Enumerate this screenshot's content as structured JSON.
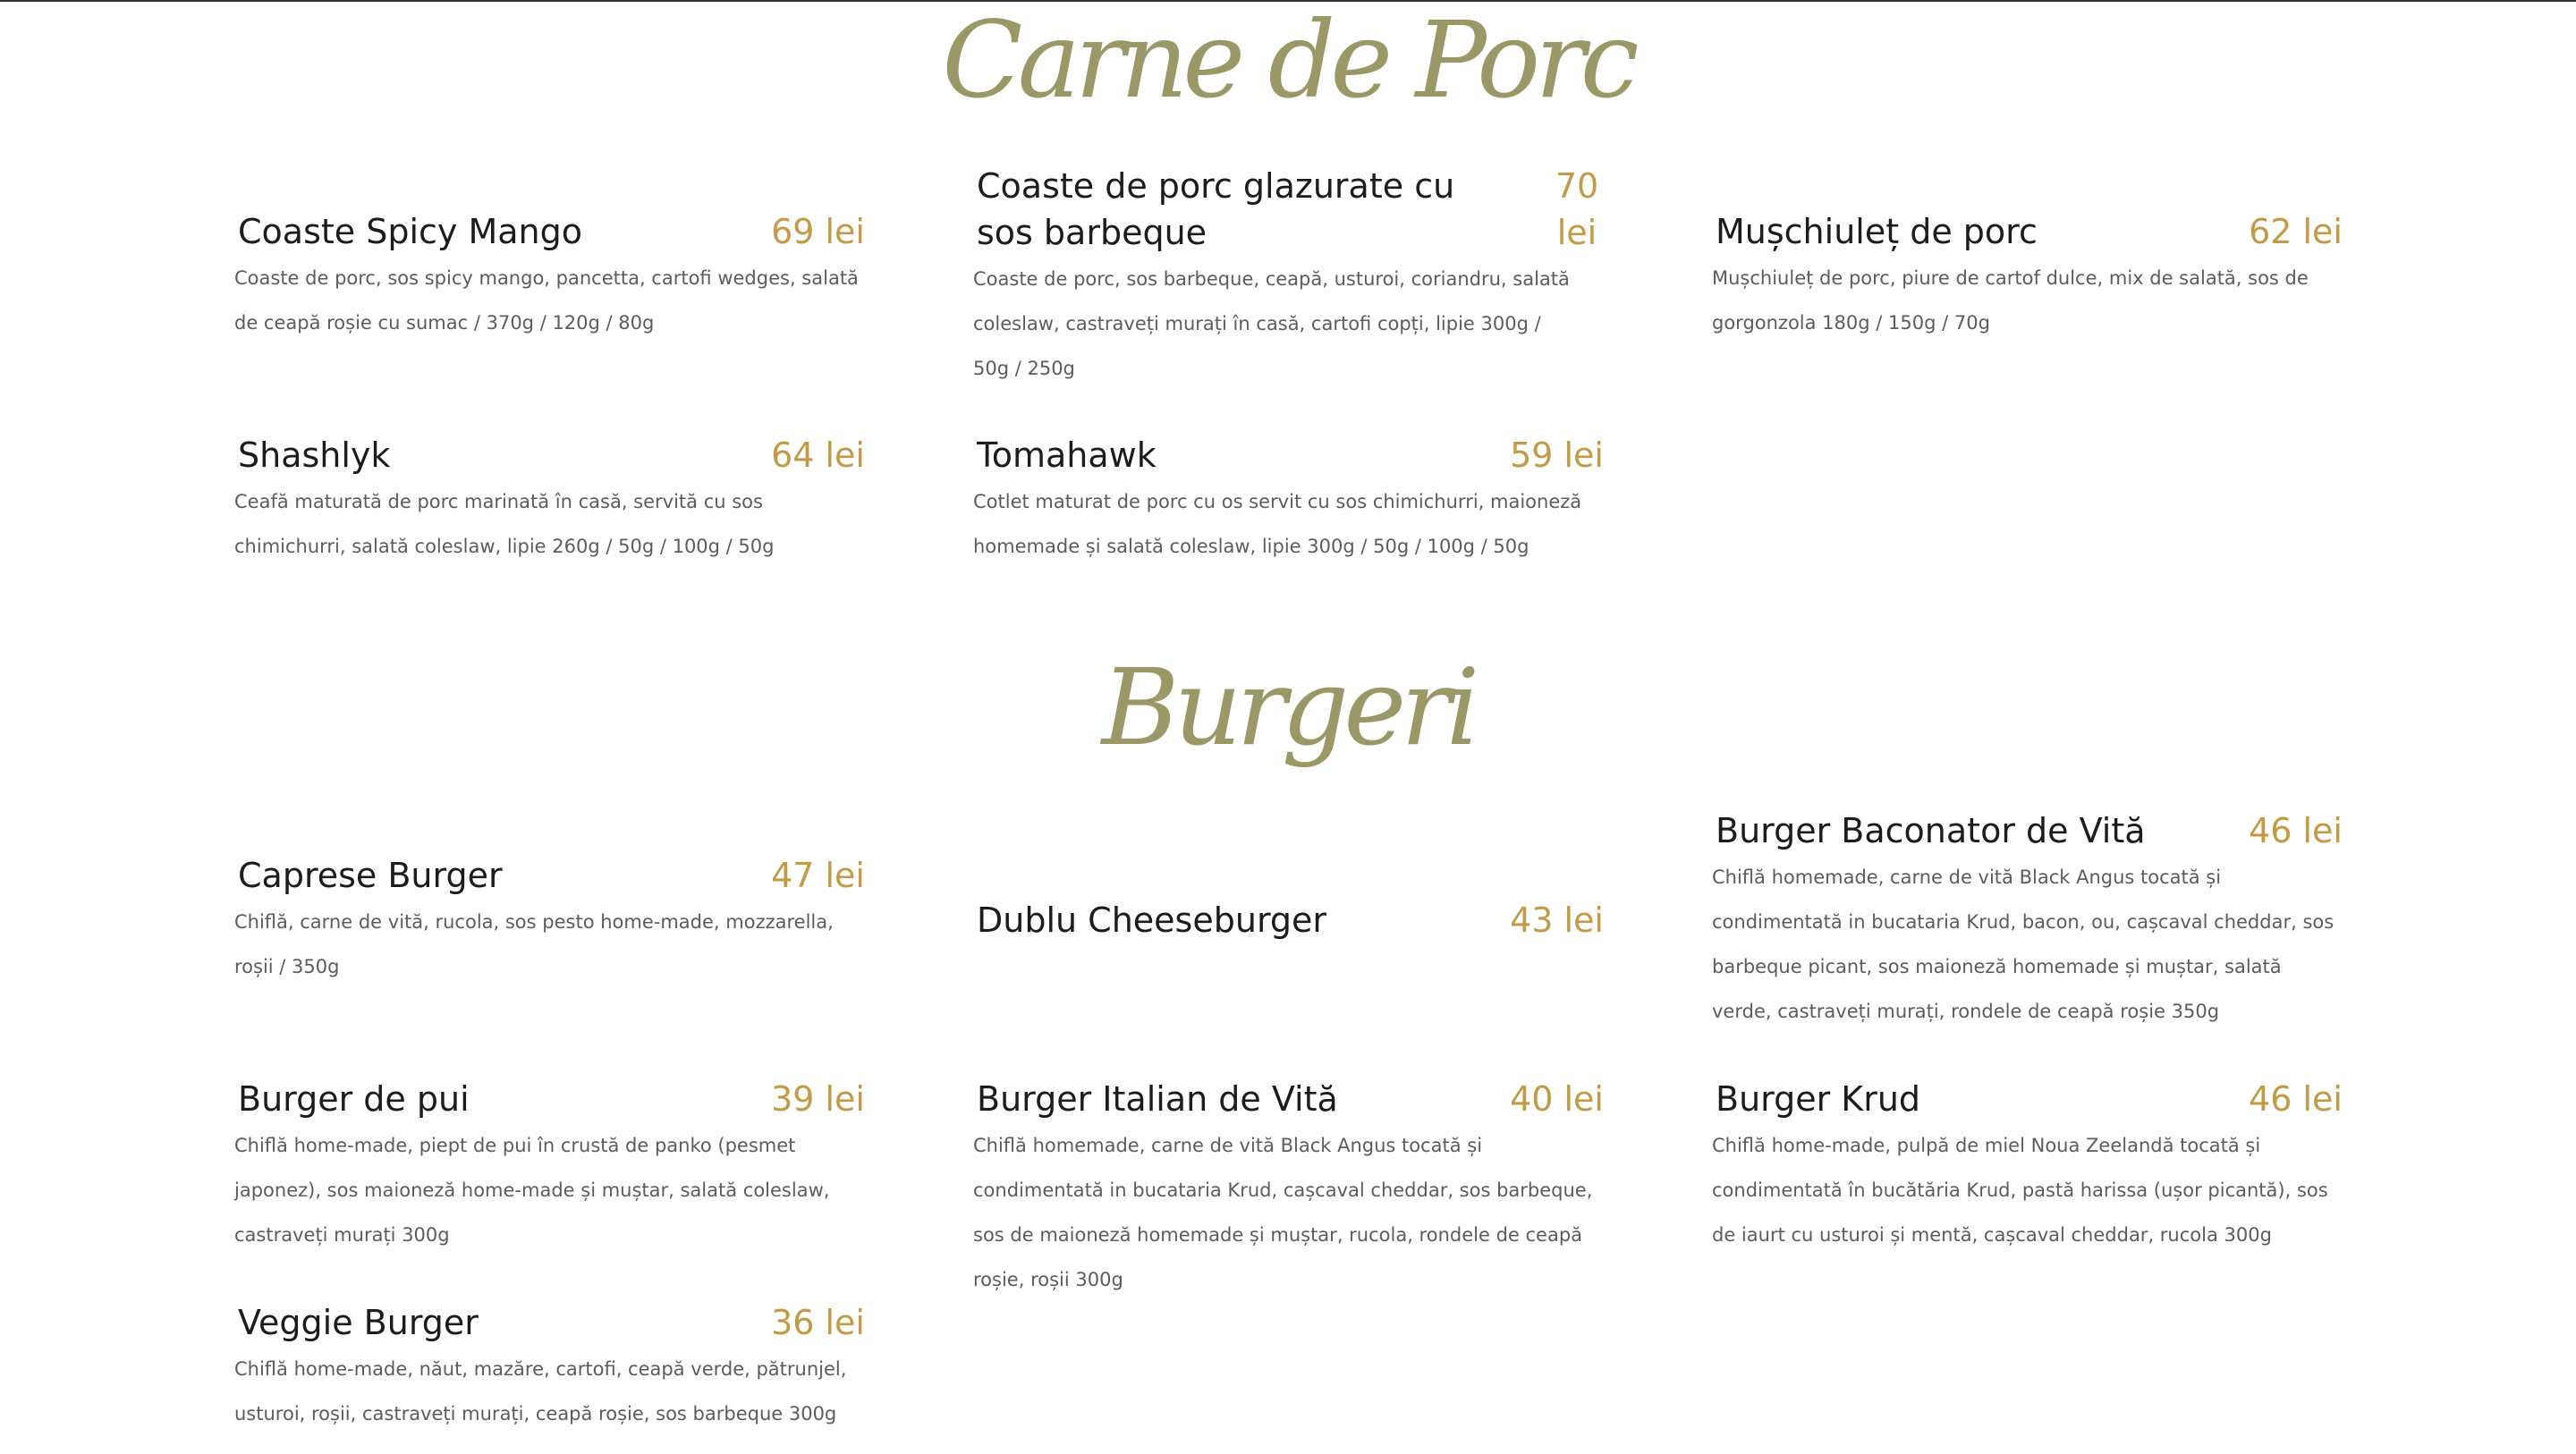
{
  "colors": {
    "heading": "#9a9866",
    "price": "#c39a45",
    "name": "#1c1c1c",
    "desc": "#5c5c5c"
  },
  "sections": {
    "porc": {
      "title": "Carne de Porc",
      "items": [
        {
          "name": "Coaste Spicy Mango",
          "price": "69 lei",
          "desc": "Coaste de porc, sos spicy mango, pancetta, cartofi wedges, salată de ceapă roșie cu sumac / 370g / 120g / 80g"
        },
        {
          "name": "Coaste de porc glazurate cu sos barbeque",
          "price": "70 lei",
          "desc": "Coaste de porc, sos barbeque, ceapă, usturoi, coriandru, salată coleslaw, castraveți murați în casă, cartofi copți, lipie 300g / 50g / 250g"
        },
        {
          "name": "Mușchiuleț de porc",
          "price": "62 lei",
          "desc": "Mușchiuleț de porc, piure de cartof dulce, mix de salată, sos de gorgonzola 180g / 150g / 70g"
        },
        {
          "name": "Shashlyk",
          "price": "64 lei",
          "desc": "Ceafă maturată de porc marinată în casă, servită cu sos chimichurri, salată coleslaw, lipie 260g / 50g / 100g / 50g"
        },
        {
          "name": "Tomahawk",
          "price": "59 lei",
          "desc": "Cotlet maturat de porc cu os servit cu sos chimichurri, maioneză homemade și salată coleslaw, lipie 300g / 50g / 100g / 50g"
        }
      ]
    },
    "burgeri": {
      "title": "Burgeri",
      "items": [
        {
          "name": "Caprese Burger",
          "price": "47 lei",
          "desc": "Chiflă, carne de vită, rucola, sos pesto home-made, mozzarella, roșii / 350g"
        },
        {
          "name": "Dublu Cheeseburger",
          "price": "43 lei",
          "desc": ""
        },
        {
          "name": "Burger Baconator de Vită",
          "price": "46 lei",
          "desc": "Chiflă homemade, carne de vită Black Angus tocată și condimentată in bucataria Krud, bacon, ou, cașcaval cheddar, sos barbeque picant, sos maioneză homemade și muștar, salată verde, castraveți murați, rondele de ceapă roșie 350g"
        },
        {
          "name": "Burger de pui",
          "price": "39 lei",
          "desc": "Chiflă home-made, piept de pui în crustă de panko (pesmet japonez), sos maioneză home-made și muștar, salată coleslaw, castraveți murați 300g"
        },
        {
          "name": "Burger Italian de Vită",
          "price": "40 lei",
          "desc": "Chiflă homemade, carne de vită Black Angus tocată și condimentată in bucataria Krud, cașcaval cheddar, sos barbeque, sos de maioneză homemade și muștar, rucola, rondele de ceapă roșie, roșii 300g"
        },
        {
          "name": "Burger Krud",
          "price": "46 lei",
          "desc": "Chiflă home-made, pulpă de miel Noua Zeelandă tocată și condimentată în bucătăria Krud, pastă harissa (ușor picantă), sos de iaurt cu usturoi și mentă, cașcaval cheddar, rucola 300g"
        },
        {
          "name": "Veggie Burger",
          "price": "36 lei",
          "desc": "Chiflă home-made, năut, mazăre, cartofi, ceapă verde, pătrunjel, usturoi, roșii, castraveți murați, ceapă roșie, sos barbeque 300g"
        }
      ]
    }
  }
}
